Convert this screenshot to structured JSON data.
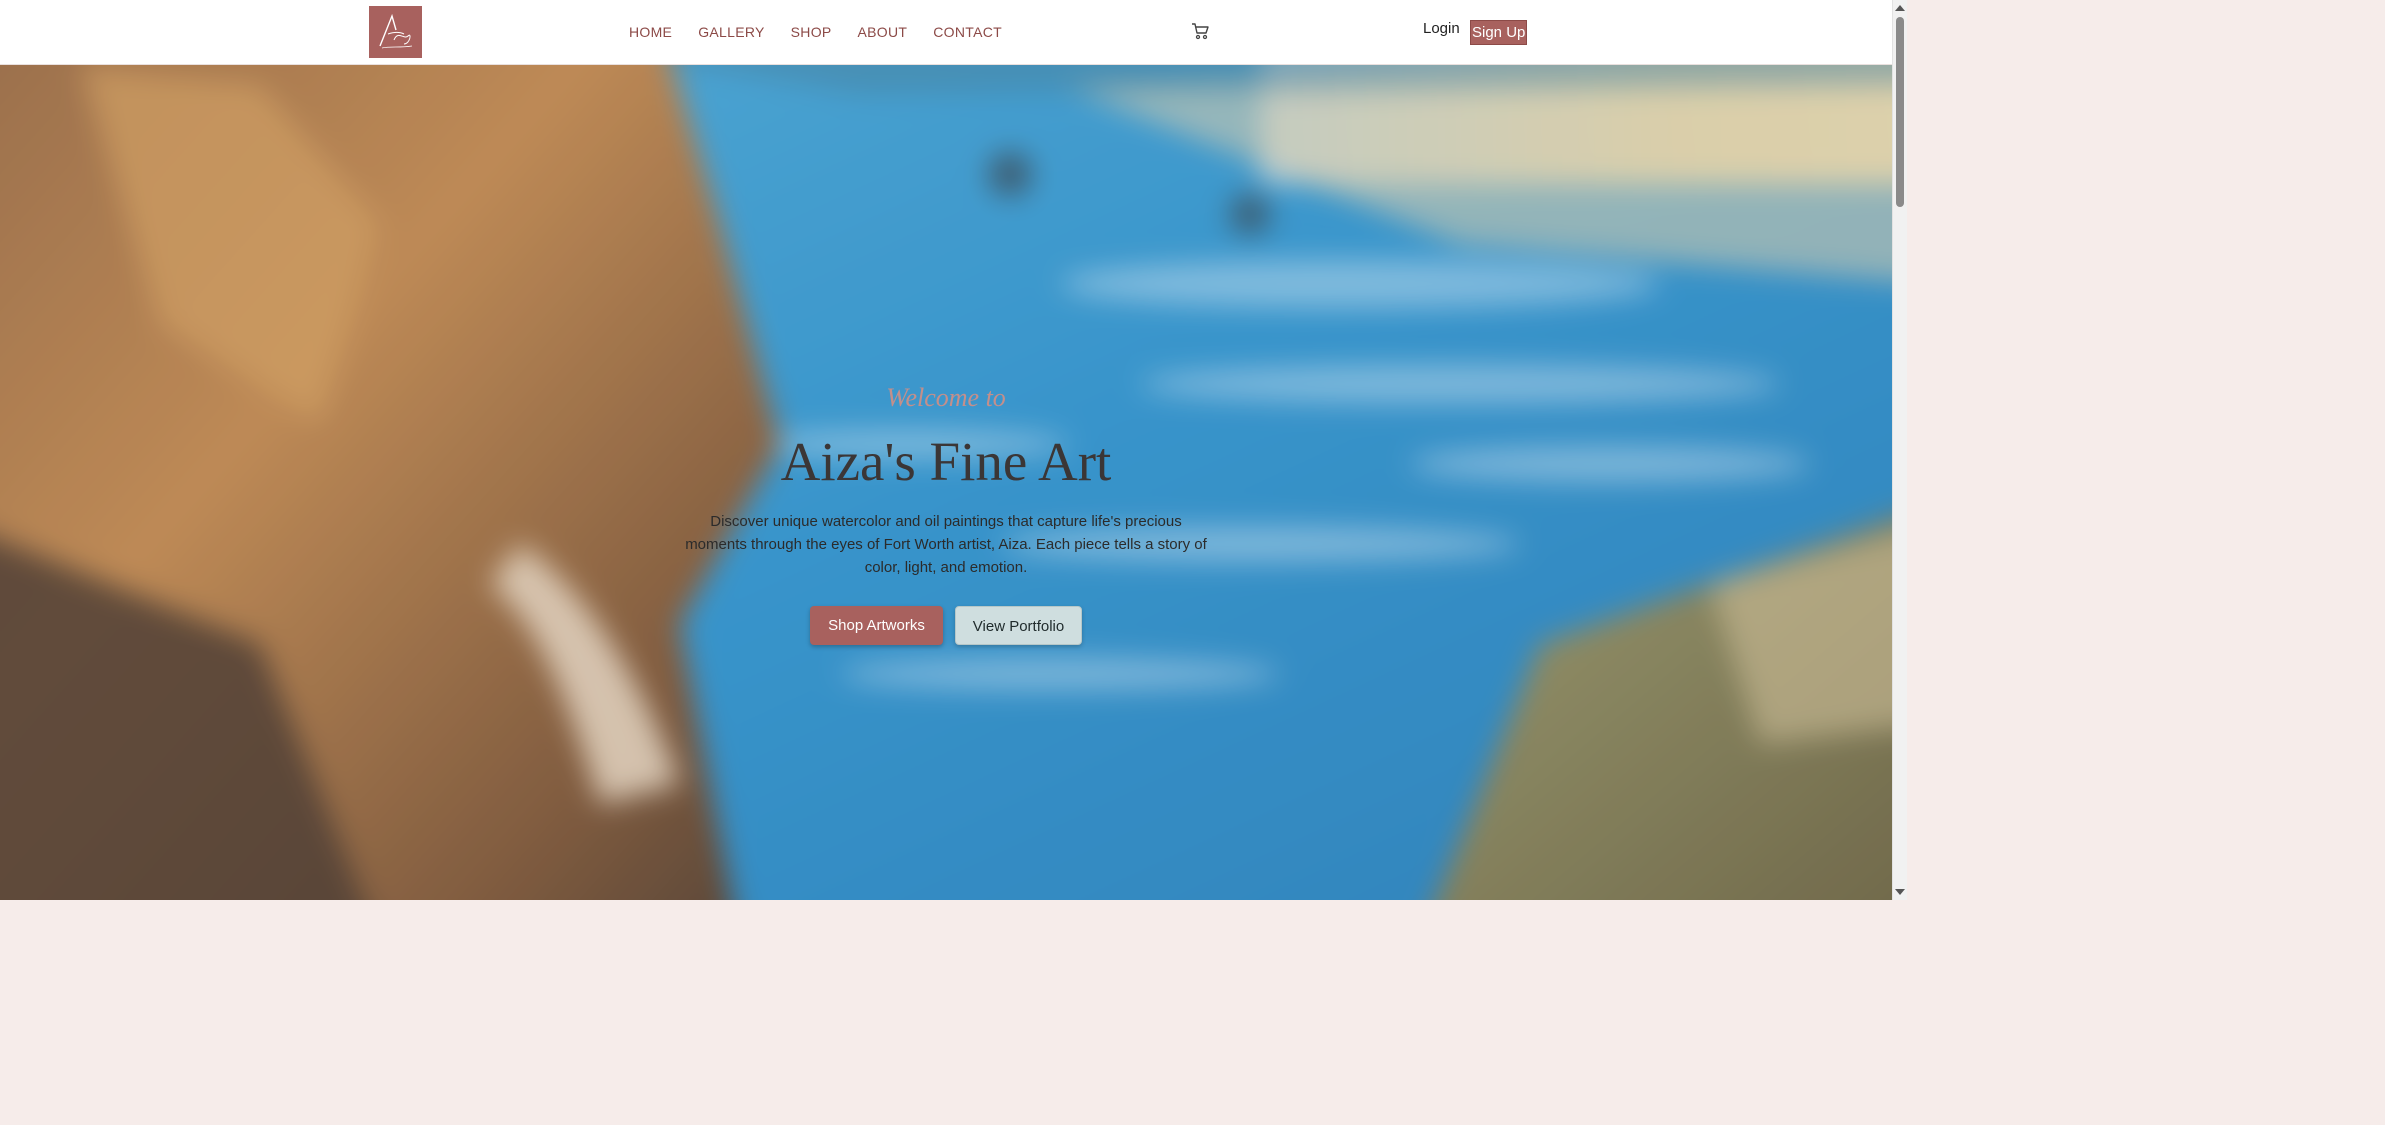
{
  "nav": {
    "logo_label": "Aiza logo",
    "links": [
      "HOME",
      "GALLERY",
      "SHOP",
      "ABOUT",
      "CONTACT"
    ],
    "login": "Login",
    "signup": "Sign Up"
  },
  "hero": {
    "welcome": "Welcome to",
    "title": "Aiza's Fine Art",
    "description": "Discover unique watercolor and oil paintings that capture life's precious moments through the eyes of Fort Worth artist, Aiza. Each piece tells a story of color, light, and emotion.",
    "primary_button": "Shop Artworks",
    "secondary_button": "View Portfolio"
  },
  "colors": {
    "accent": "#a8615e",
    "nav_text": "#8c4a47",
    "welcome_text": "#c48f8b",
    "secondary_button": "#cfdedf",
    "page_background": "#f6ecea"
  },
  "icons": {
    "cart": "shopping-cart-icon",
    "logo": "aiza-monogram-logo"
  }
}
